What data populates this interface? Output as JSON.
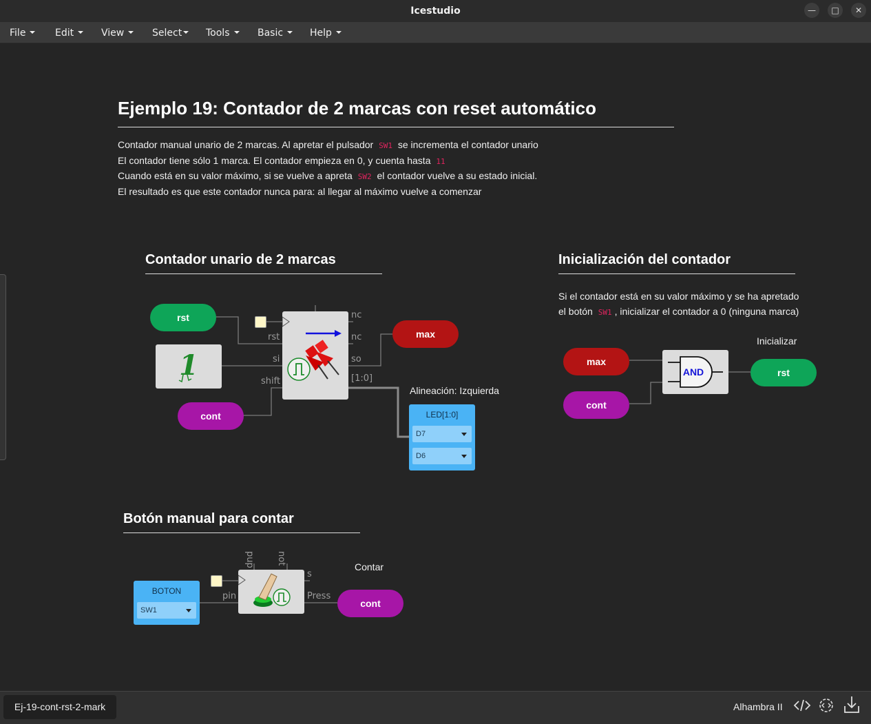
{
  "window": {
    "title": "Icestudio"
  },
  "menu": [
    "File",
    "Edit",
    "View",
    "Select",
    "Tools",
    "Basic",
    "Help"
  ],
  "main": {
    "title": "Ejemplo 19: Contador de 2 marcas con reset automático",
    "desc": {
      "l1a": "Contador manual unario de 2 marcas. Al apretar el pulsador",
      "l1code": "SW1",
      "l1b": "se incrementa el contador unario",
      "l2a": "El contador tiene sólo 1 marca. El contador empieza en 0, y cuenta hasta",
      "l2code": "11",
      "l3a": "Cuando está en su valor máximo, si se vuelve a apreta",
      "l3code": "SW2",
      "l3b": "el contador vuelve a su estado inicial.",
      "l4": "El resultado es que este contador nunca para: al llegar al máximo vuelve a comenzar"
    }
  },
  "section_counter": {
    "title": "Contador unario de 2 marcas",
    "rst": "rst",
    "max": "max",
    "cont": "cont",
    "const_value": "1",
    "pins": {
      "rst": "rst",
      "si": "si",
      "shift": "shift",
      "nc1": "nc",
      "nc2": "nc",
      "so": "so",
      "bus": "[1:0]"
    },
    "align_label": "Alineación: Izquierda",
    "led": {
      "title": "LED[1:0]",
      "opt1": "D7",
      "opt2": "D6"
    }
  },
  "section_init": {
    "title": "Inicialización del contador",
    "text1": "Si el contador está en su valor máximo y se ha apretado",
    "text2a": "el botón",
    "text2code": "SW1",
    "text2b": ", inicializar el contador a 0 (ninguna marca)",
    "output_label": "Inicializar",
    "max": "max",
    "cont": "cont",
    "gate": "AND",
    "rst": "rst"
  },
  "section_button": {
    "title": "Botón manual para contar",
    "panel_title": "BOTON",
    "panel_value": "SW1",
    "pins": {
      "pin": "pin",
      "pup": "pup",
      "not": "not",
      "s": "s",
      "press": "Press"
    },
    "output_label": "Contar",
    "cont": "cont"
  },
  "bottom": {
    "filename": "Ej-19-cont-rst-2-mark",
    "board": "Alhambra II"
  },
  "colors": {
    "green": "#0ea558",
    "red": "#b31414",
    "purple": "#a716a7",
    "blue": "#4ab3f5"
  }
}
